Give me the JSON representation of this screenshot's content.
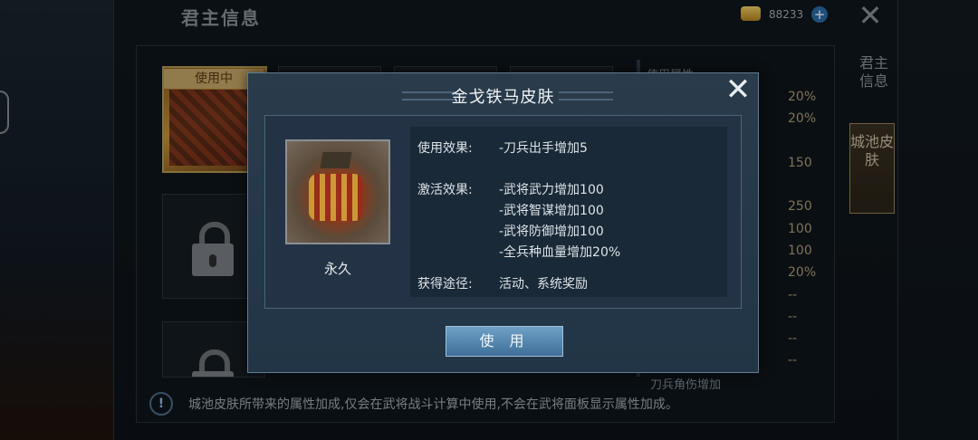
{
  "header": {
    "title": "君主信息",
    "gold_amount": "88233",
    "plus_label": "+",
    "close_label": "✕"
  },
  "skins": {
    "in_use_label": "使用中"
  },
  "stats": {
    "header": "使用属性",
    "values": [
      "20%",
      "20%",
      "150",
      "250",
      "100",
      "100",
      "20%",
      "--",
      "--",
      "--",
      "--"
    ],
    "bottom_label": "刀兵角伤增加"
  },
  "side_tabs": {
    "tab1": "君主信息",
    "tab2": "城池皮肤"
  },
  "notice": {
    "icon": "!",
    "text": "城池皮肤所带来的属性加成,仅会在武将战斗计算中使用,不会在武将面板显示属性加成。"
  },
  "modal": {
    "title": "金戈铁马皮肤",
    "close_label": "✕",
    "duration": "永久",
    "use_effect_label": "使用效果:",
    "use_effect_value": "-刀兵出手增加5",
    "activate_effect_label": "激活效果:",
    "activate_effects": [
      "-武将武力增加100",
      "-武将智谋增加100",
      "-武将防御增加100",
      "-全兵种血量增加20%"
    ],
    "obtain_label": "获得途径:",
    "obtain_value": "活动、系统奖励",
    "use_button": "使 用"
  }
}
